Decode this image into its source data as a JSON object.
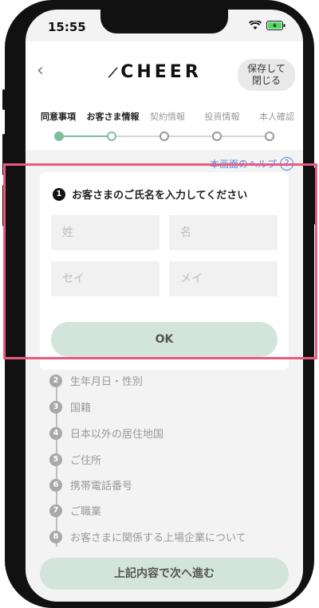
{
  "status": {
    "time": "15:55"
  },
  "header": {
    "back_icon": "chevron-left-icon",
    "logo": "CHEER",
    "save_label_1": "保存して",
    "save_label_2": "閉じる"
  },
  "steps": [
    {
      "label": "同意事項",
      "state": "done"
    },
    {
      "label": "お客さま情報",
      "state": "current"
    },
    {
      "label": "契約情報",
      "state": "todo"
    },
    {
      "label": "投資情報",
      "state": "todo"
    },
    {
      "label": "本人確認",
      "state": "todo"
    }
  ],
  "help": {
    "label": "本画面のヘルプ",
    "icon": "?"
  },
  "question": {
    "number": "1",
    "title": "お客さまのご氏名を入力してください",
    "fields": {
      "last_name": {
        "placeholder": "姓",
        "value": ""
      },
      "first_name": {
        "placeholder": "名",
        "value": ""
      },
      "last_kana": {
        "placeholder": "セイ",
        "value": ""
      },
      "first_kana": {
        "placeholder": "メイ",
        "value": ""
      }
    },
    "ok_label": "OK"
  },
  "pending_questions": [
    {
      "number": "2",
      "label": "生年月日・性別"
    },
    {
      "number": "3",
      "label": "国籍"
    },
    {
      "number": "4",
      "label": "日本以外の居住地国"
    },
    {
      "number": "5",
      "label": "ご住所"
    },
    {
      "number": "6",
      "label": "携帯電話番号"
    },
    {
      "number": "7",
      "label": "ご職業"
    },
    {
      "number": "8",
      "label": "お客さまに関係する上場企業について"
    }
  ],
  "footer": {
    "next_label": "上記内容で次へ進む"
  },
  "colors": {
    "accent": "#7fbf9f",
    "highlight": "#ea5a80",
    "link": "#4f8bd6"
  }
}
